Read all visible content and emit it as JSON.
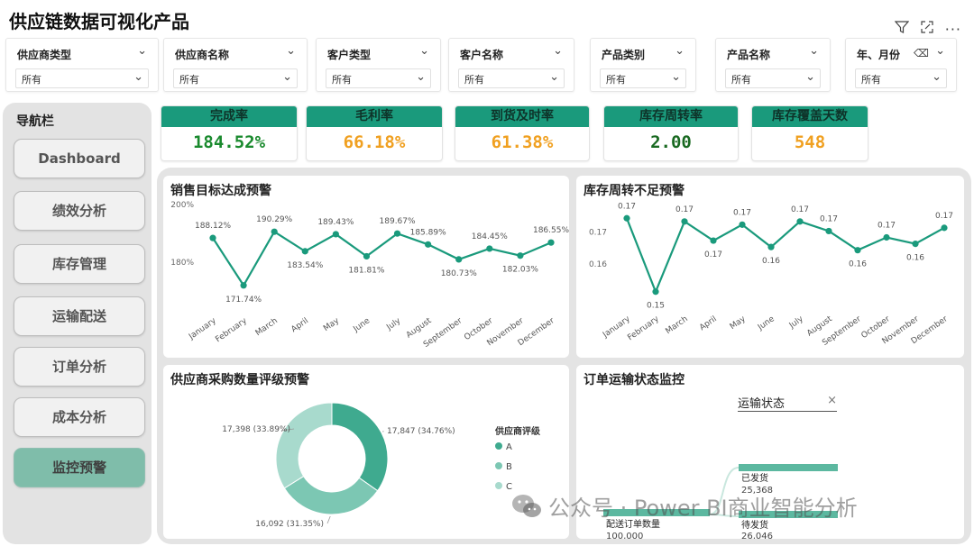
{
  "title": "供应链数据可视化产品",
  "filters": [
    {
      "label": "供应商类型",
      "value": "所有"
    },
    {
      "label": "供应商名称",
      "value": "所有"
    },
    {
      "label": "客户类型",
      "value": "所有"
    },
    {
      "label": "客户名称",
      "value": "所有"
    },
    {
      "label": "产品类别",
      "value": "所有"
    },
    {
      "label": "产品名称",
      "value": "所有"
    },
    {
      "label": "年、月份",
      "value": "所有"
    }
  ],
  "nav": {
    "title": "导航栏",
    "items": [
      "Dashboard",
      "绩效分析",
      "库存管理",
      "运输配送",
      "订单分析",
      "成本分析",
      "监控预警"
    ],
    "active": "监控预警"
  },
  "kpis": [
    {
      "label": "完成率",
      "value": "184.52%",
      "color": "#1a8a2e"
    },
    {
      "label": "毛利率",
      "value": "66.18%",
      "color": "#f0a020"
    },
    {
      "label": "到货及时率",
      "value": "61.38%",
      "color": "#f0a020"
    },
    {
      "label": "库存周转率",
      "value": "2.00",
      "color": "#1a6a22"
    },
    {
      "label": "库存覆盖天数",
      "value": "548",
      "color": "#f0a020"
    }
  ],
  "panels": {
    "sales": "销售目标达成预警",
    "inventory": "库存周转不足预警",
    "supplier": "供应商采购数量评级预警",
    "shipping": "订单运输状态监控"
  },
  "chart_data": [
    {
      "type": "line",
      "title": "销售目标达成预警",
      "x": [
        "January",
        "February",
        "March",
        "April",
        "May",
        "June",
        "July",
        "August",
        "September",
        "October",
        "November",
        "December"
      ],
      "series": [
        {
          "values": [
            188.12,
            171.74,
            190.29,
            183.54,
            189.43,
            181.81,
            189.67,
            185.89,
            180.73,
            184.45,
            182.03,
            186.55
          ]
        }
      ],
      "data_labels": [
        "188.12%",
        "171.74%",
        "190.29%",
        "183.54%",
        "189.43%",
        "181.81%",
        "189.67%",
        "185.89%",
        "180.73%",
        "184.45%",
        "182.03%",
        "186.55%"
      ],
      "yticks": [
        "200%",
        "180%"
      ],
      "ylim": [
        167,
        200
      ],
      "color": "#1a9a7c"
    },
    {
      "type": "line",
      "title": "库存周转不足预警",
      "x": [
        "January",
        "February",
        "March",
        "April",
        "May",
        "June",
        "July",
        "August",
        "September",
        "October",
        "November",
        "December"
      ],
      "series": [
        {
          "values": [
            0.174,
            0.151,
            0.173,
            0.167,
            0.172,
            0.165,
            0.173,
            0.17,
            0.164,
            0.168,
            0.166,
            0.171
          ]
        }
      ],
      "data_labels": [
        "0.17",
        "0.15",
        "0.17",
        "0.17",
        "0.17",
        "0.16",
        "0.17",
        "0.17",
        "0.16",
        "0.17",
        "0.16",
        "0.17"
      ],
      "yticks": [
        "0.17",
        "0.16"
      ],
      "ylim": [
        0.145,
        0.18
      ],
      "color": "#1a9a7c"
    },
    {
      "type": "pie",
      "title": "供应商采购数量评级预警",
      "legend_title": "供应商评级",
      "categories": [
        "A",
        "B",
        "C"
      ],
      "values": [
        17847,
        16092,
        17398
      ],
      "labels": [
        "17,847 (34.76%)",
        "16,092 (31.35%)",
        "17,398 (33.89%)"
      ],
      "colors": [
        "#3faa8f",
        "#7cc7b3",
        "#a8dacd"
      ]
    }
  ],
  "shipping": {
    "slicer_label": "运输状态",
    "slicer_clear": "×",
    "root_label": "配送订单数量",
    "root_value": "100,000",
    "nodes": [
      {
        "label": "已发货",
        "value": "25,368"
      },
      {
        "label": "待发货",
        "value": "26,046"
      }
    ]
  },
  "watermark": "公众号 · Power BI商业智能分析",
  "icons": {
    "filter": "filter-icon",
    "expand": "focus-mode-icon",
    "more": "more-options-icon",
    "eraser": "clear-selection-icon"
  }
}
